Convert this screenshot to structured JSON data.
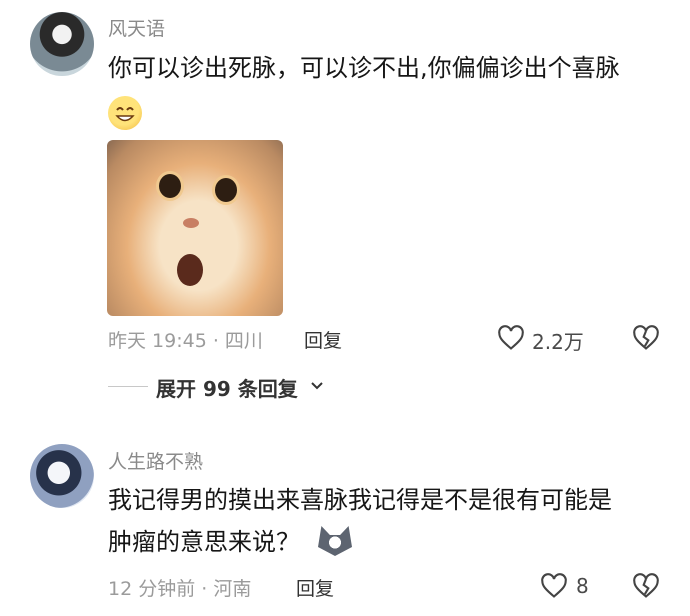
{
  "comments": [
    {
      "username": "风天语",
      "text": "你可以诊出死脉，可以诊不出,你偏偏诊出个喜脉",
      "emoji": "smile-emoji",
      "time": "昨天 19:45 · 四川",
      "reply": "回复",
      "likes": "2.2万",
      "expand": "展开 99 条回复"
    },
    {
      "username": "人生路不熟",
      "text_line1": "我记得男的摸出来喜脉我记得是不是很有可能是",
      "text_line2": "肿瘤的意思来说？",
      "emoji": "wolf-emoji",
      "time": "12 分钟前 · 河南",
      "reply": "回复",
      "likes": "8"
    }
  ],
  "icons": {
    "like": "heart-outline-icon",
    "dislike": "broken-heart-icon",
    "expand": "chevron-down-icon"
  }
}
